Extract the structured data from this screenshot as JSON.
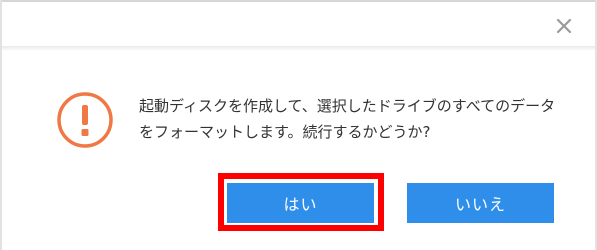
{
  "dialog": {
    "close_icon": "close-icon",
    "warning_icon": "exclamation-circle-icon",
    "warning_color": "#f07845",
    "accent_color": "#2f8eea",
    "highlight_color": "#ff0000",
    "message_line1": "起動ディスクを作成して、選択したドライブのすべてのデータ",
    "message_line2": "をフォーマットします。続行するかどうか?",
    "yes_label": "はい",
    "no_label": "いいえ"
  }
}
